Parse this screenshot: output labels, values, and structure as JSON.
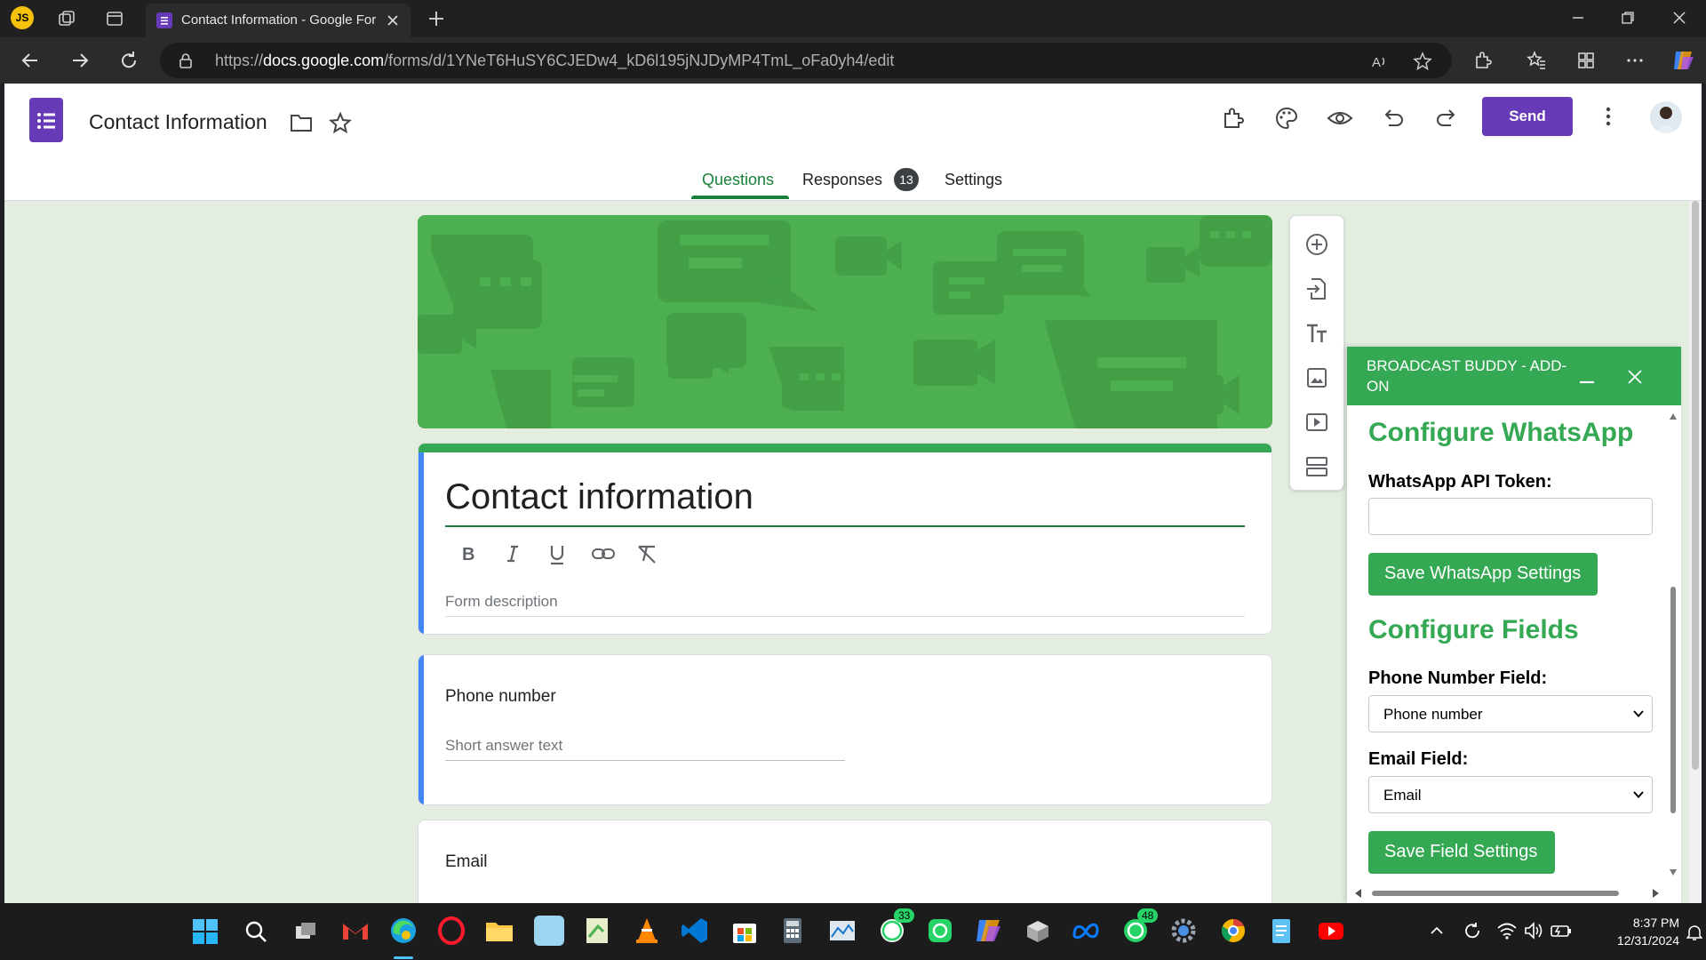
{
  "browser": {
    "profile_initials": "JS",
    "tab_title": "Contact Information - Google For",
    "url_prefix": "https://",
    "url_domain": "docs.google.com",
    "url_path": "/forms/d/1YNeT6HuSY6CJEDw4_kD6l195jNJDyMP4TmL_oFa0yh4/edit"
  },
  "forms_header": {
    "doc_title": "Contact Information",
    "send_label": "Send",
    "tabs": [
      {
        "label": "Questions"
      },
      {
        "label": "Responses",
        "badge": "13"
      },
      {
        "label": "Settings"
      }
    ]
  },
  "form": {
    "title": "Contact information",
    "description_placeholder": "Form description",
    "questions": [
      {
        "title": "Phone number",
        "answer_hint": "Short answer text"
      },
      {
        "title": "Email"
      }
    ]
  },
  "addon": {
    "header_title": "BROADCAST BUDDY - ADD-ON",
    "section_whatsapp": "Configure WhatsApp",
    "api_token_label": "WhatsApp API Token:",
    "api_token_value": "",
    "save_whatsapp_label": "Save WhatsApp Settings",
    "section_fields": "Configure Fields",
    "phone_field_label": "Phone Number Field:",
    "phone_field_value": "Phone number",
    "email_field_label": "Email Field:",
    "email_field_value": "Email",
    "save_fields_label": "Save Field Settings"
  },
  "taskbar": {
    "whatsapp_badge_1": "33",
    "whatsapp_badge_2": "48",
    "time": "8:37 PM",
    "date": "12/31/2024"
  },
  "colors": {
    "forms_green": "#34a853",
    "banner_green": "#4caf50",
    "send_purple": "#673ab7",
    "focus_blue": "#4285f4"
  }
}
